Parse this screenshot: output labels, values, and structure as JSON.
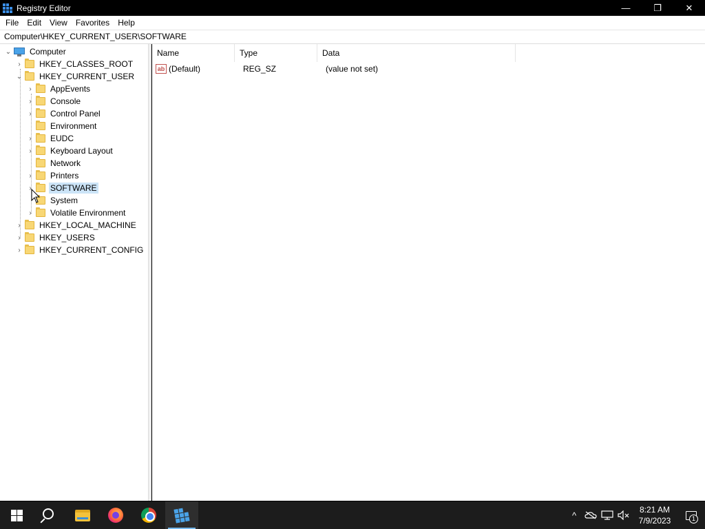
{
  "window": {
    "title": "Registry Editor",
    "controls": {
      "minimize": "—",
      "maximize": "❐",
      "close": "✕"
    }
  },
  "menu": [
    "File",
    "Edit",
    "View",
    "Favorites",
    "Help"
  ],
  "address": "Computer\\HKEY_CURRENT_USER\\SOFTWARE",
  "tree": {
    "root": "Computer",
    "items": [
      {
        "label": "HKEY_CLASSES_ROOT"
      },
      {
        "label": "HKEY_CURRENT_USER"
      },
      {
        "label": "AppEvents"
      },
      {
        "label": "Console"
      },
      {
        "label": "Control Panel"
      },
      {
        "label": "Environment"
      },
      {
        "label": "EUDC"
      },
      {
        "label": "Keyboard Layout"
      },
      {
        "label": "Network"
      },
      {
        "label": "Printers"
      },
      {
        "label": "SOFTWARE"
      },
      {
        "label": "System"
      },
      {
        "label": "Volatile Environment"
      },
      {
        "label": "HKEY_LOCAL_MACHINE"
      },
      {
        "label": "HKEY_USERS"
      },
      {
        "label": "HKEY_CURRENT_CONFIG"
      }
    ],
    "selected": "SOFTWARE"
  },
  "list": {
    "columns": [
      "Name",
      "Type",
      "Data"
    ],
    "rows": [
      {
        "name": "(Default)",
        "type": "REG_SZ",
        "data": "(value not set)",
        "icon": "ab"
      }
    ]
  },
  "taskbar": {
    "apps": [
      "start-icon",
      "search-icon",
      "file-explorer-icon",
      "firefox-icon",
      "chrome-icon",
      "registry-editor-icon"
    ],
    "tray": {
      "chevron": "^",
      "time": "8:21 AM",
      "date": "7/9/2023",
      "notification_count": "1"
    }
  },
  "colors": {
    "selection": "#cce4f7",
    "taskbar": "#1c1c1c",
    "folder": "#f8d775"
  }
}
